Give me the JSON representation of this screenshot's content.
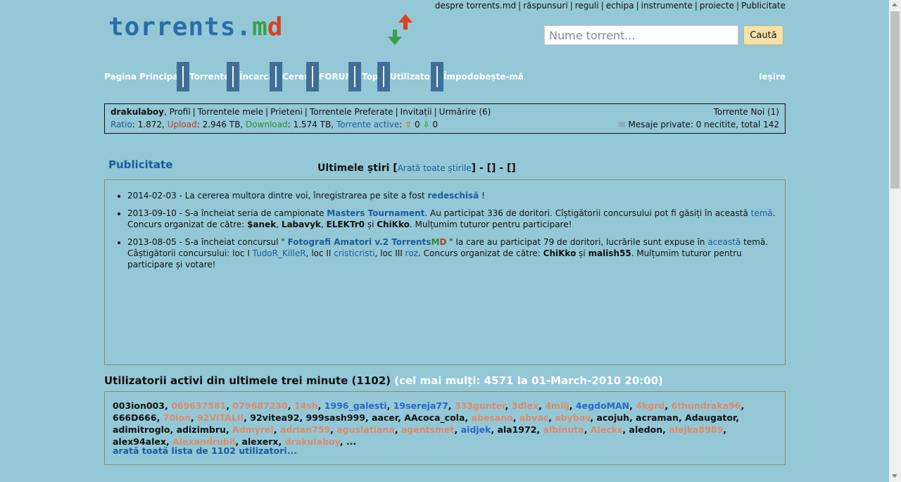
{
  "top_links": [
    "despre torrents.md",
    "răspunsuri",
    "reguli",
    "echipa",
    "instrumente",
    "proiecte",
    "Publicitate"
  ],
  "logo": {
    "part1": "torrents.",
    "part2": "m",
    "part3": "d"
  },
  "search": {
    "placeholder": "Nume torrent...",
    "button": "Caută"
  },
  "nav": {
    "items": [
      "Pagina Principală",
      "Torrente",
      "Încarcă",
      "Cereri",
      "FORUM",
      "Top",
      "Utilizatori",
      "Împodobește-mă"
    ],
    "logout": "Ieșire"
  },
  "userbox": {
    "username": "drakulaboy",
    "links": [
      "Profil",
      "Torrentele mele",
      "Prieteni",
      "Torrentele Preferate",
      "Invitații",
      "Urmărire (6)"
    ],
    "ratio_label": "Ratio",
    "ratio_value": "1.872",
    "upload_label": "Upload",
    "upload_value": "2.946 TB",
    "download_label": "Download",
    "download_value": "1.574 TB",
    "active_label": "Torrente active",
    "active_up": "0",
    "active_down": "0",
    "new_torrents": "Torrente Noi (1)",
    "private_messages": "Mesaje private: 0 necitite, total 142"
  },
  "publicitate": "Publicitate",
  "news": {
    "title": "Ultimele știri",
    "show_all": "Arată toate știrile",
    "extra": "] - [] - []",
    "items": [
      {
        "pre": "2014-02-03 - La cererea multora dintre voi, înregistrarea pe site a fost ",
        "link": "redeschisă",
        "post": " !"
      },
      {
        "pre": "2013-09-10 - S-a încheiat seria de campionate ",
        "link": "Masters Tournament",
        "mid": ". Au participat 336 de doritori. Cîștigătorii concursului pot fi găsiți în această ",
        "link2": "temă",
        "mid2": ". Concurs organizat de către: ",
        "b1": "$anek",
        "b2": "Labavyk",
        "b3": "ELEKTr0",
        "and": " și ",
        "b4": "ChiKko",
        "post": ". Mulțumim tuturor pentru participare!"
      },
      {
        "pre": "2013-08-05 - S-a încheiat concursul \" ",
        "link": "Fotografi Amatori v.2 Torrents",
        "m": "M",
        "d": "D",
        "mid": " \" la care au participat 79 de doritori, lucrările sunt expuse în ",
        "link2": "această",
        "mid2": " temă. Câștigătorii concursului: loc I ",
        "w1": "TudoR_KilleR",
        "l2": ", loc II ",
        "w2": "cristicristi",
        "l3": ", loc III ",
        "w3": "roz",
        "mid3": ". Concurs organizat de către: ",
        "b1": "ChiKko",
        "and": " și ",
        "b2": "malish55",
        "post": ". Mulțumim tuturor pentru participare și votare!"
      }
    ]
  },
  "active_users": {
    "title": "Utilizatorii activi din ultimele trei minute (1102)",
    "most": "(cel mai mulți: 4571 la 01-March-2010 20:00)",
    "users": [
      {
        "n": "003ion003",
        "c": "black"
      },
      {
        "n": "069637581",
        "c": "orange"
      },
      {
        "n": "079687230",
        "c": "orange"
      },
      {
        "n": "14sh",
        "c": "orange"
      },
      {
        "n": "1996_galesti",
        "c": "blue"
      },
      {
        "n": "19sereja77",
        "c": "blue"
      },
      {
        "n": "333gunter",
        "c": "orange"
      },
      {
        "n": "3dlex",
        "c": "orange"
      },
      {
        "n": "4milj",
        "c": "orange"
      },
      {
        "n": "4egdoMAN",
        "c": "blue"
      },
      {
        "n": "4kgrd",
        "c": "orange"
      },
      {
        "n": "6thundraka96",
        "c": "orange"
      },
      {
        "n": "666D666",
        "c": "black"
      },
      {
        "n": "70ion",
        "c": "orange"
      },
      {
        "n": "92VITALII",
        "c": "orange"
      },
      {
        "n": "92vitea92",
        "c": "black"
      },
      {
        "n": "999sash999",
        "c": "black"
      },
      {
        "n": "aacer",
        "c": "black"
      },
      {
        "n": "AAcoca_cola",
        "c": "black"
      },
      {
        "n": "abesano",
        "c": "orange"
      },
      {
        "n": "abvac",
        "c": "orange"
      },
      {
        "n": "abybav",
        "c": "orange"
      },
      {
        "n": "acojuh",
        "c": "black"
      },
      {
        "n": "acraman",
        "c": "black"
      },
      {
        "n": "Adaugator",
        "c": "black"
      },
      {
        "n": "adimitroglo",
        "c": "black"
      },
      {
        "n": "adizimbru",
        "c": "black"
      },
      {
        "n": "Admyrel",
        "c": "orange"
      },
      {
        "n": "adrian759",
        "c": "orange"
      },
      {
        "n": "aguslatiana",
        "c": "orange"
      },
      {
        "n": "agentsmet",
        "c": "orange"
      },
      {
        "n": "aidjek",
        "c": "blue"
      },
      {
        "n": "ala1972",
        "c": "black"
      },
      {
        "n": "albinuta",
        "c": "orange"
      },
      {
        "n": "Alecks",
        "c": "orange"
      },
      {
        "n": "aledon",
        "c": "black"
      },
      {
        "n": "alejka8989",
        "c": "orange"
      },
      {
        "n": "alex94alex",
        "c": "black"
      },
      {
        "n": "Alexandrubli",
        "c": "orange"
      },
      {
        "n": "alexerx",
        "c": "black"
      },
      {
        "n": "drakulaboy",
        "c": "orange"
      }
    ],
    "ellipsis": "...",
    "show_all": "arată toată lista de 1102 utilizatori..."
  },
  "colors": {
    "background": "#94c8d6",
    "link": "#1c5a9e",
    "nav_sep": "#3f6f97"
  }
}
